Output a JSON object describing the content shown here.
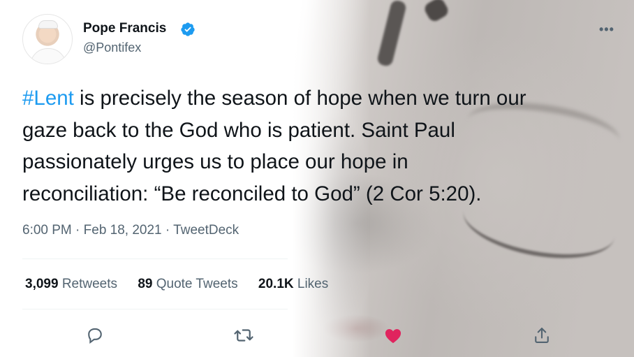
{
  "author": {
    "name": "Pope Francis",
    "handle": "@Pontifex"
  },
  "tweet": {
    "hashtag": "#Lent",
    "line1_rest": " is precisely the season of hope when we turn our",
    "line2": "gaze back to the God who is patient. Saint Paul",
    "line3": "passionately urges us to place our hope in",
    "line4": "reconciliation: “Be reconciled to God” (2 Cor 5:20)."
  },
  "meta": "6:00 PM · Feb 18, 2021 · TweetDeck",
  "stats": {
    "retweets_count": "3,099",
    "retweets_label": "Retweets",
    "quotes_count": "89",
    "quotes_label": "Quote Tweets",
    "likes_count": "20.1K",
    "likes_label": "Likes"
  },
  "icons": {
    "verified": "verified-badge-icon",
    "more": "more-icon",
    "reply": "reply-icon",
    "retweet": "retweet-icon",
    "like": "heart-icon",
    "share": "share-icon"
  },
  "colors": {
    "hashtag": "#1d9bf0",
    "verified": "#1d9bf0",
    "like": "#e0245e",
    "secondary_text": "#536471"
  }
}
